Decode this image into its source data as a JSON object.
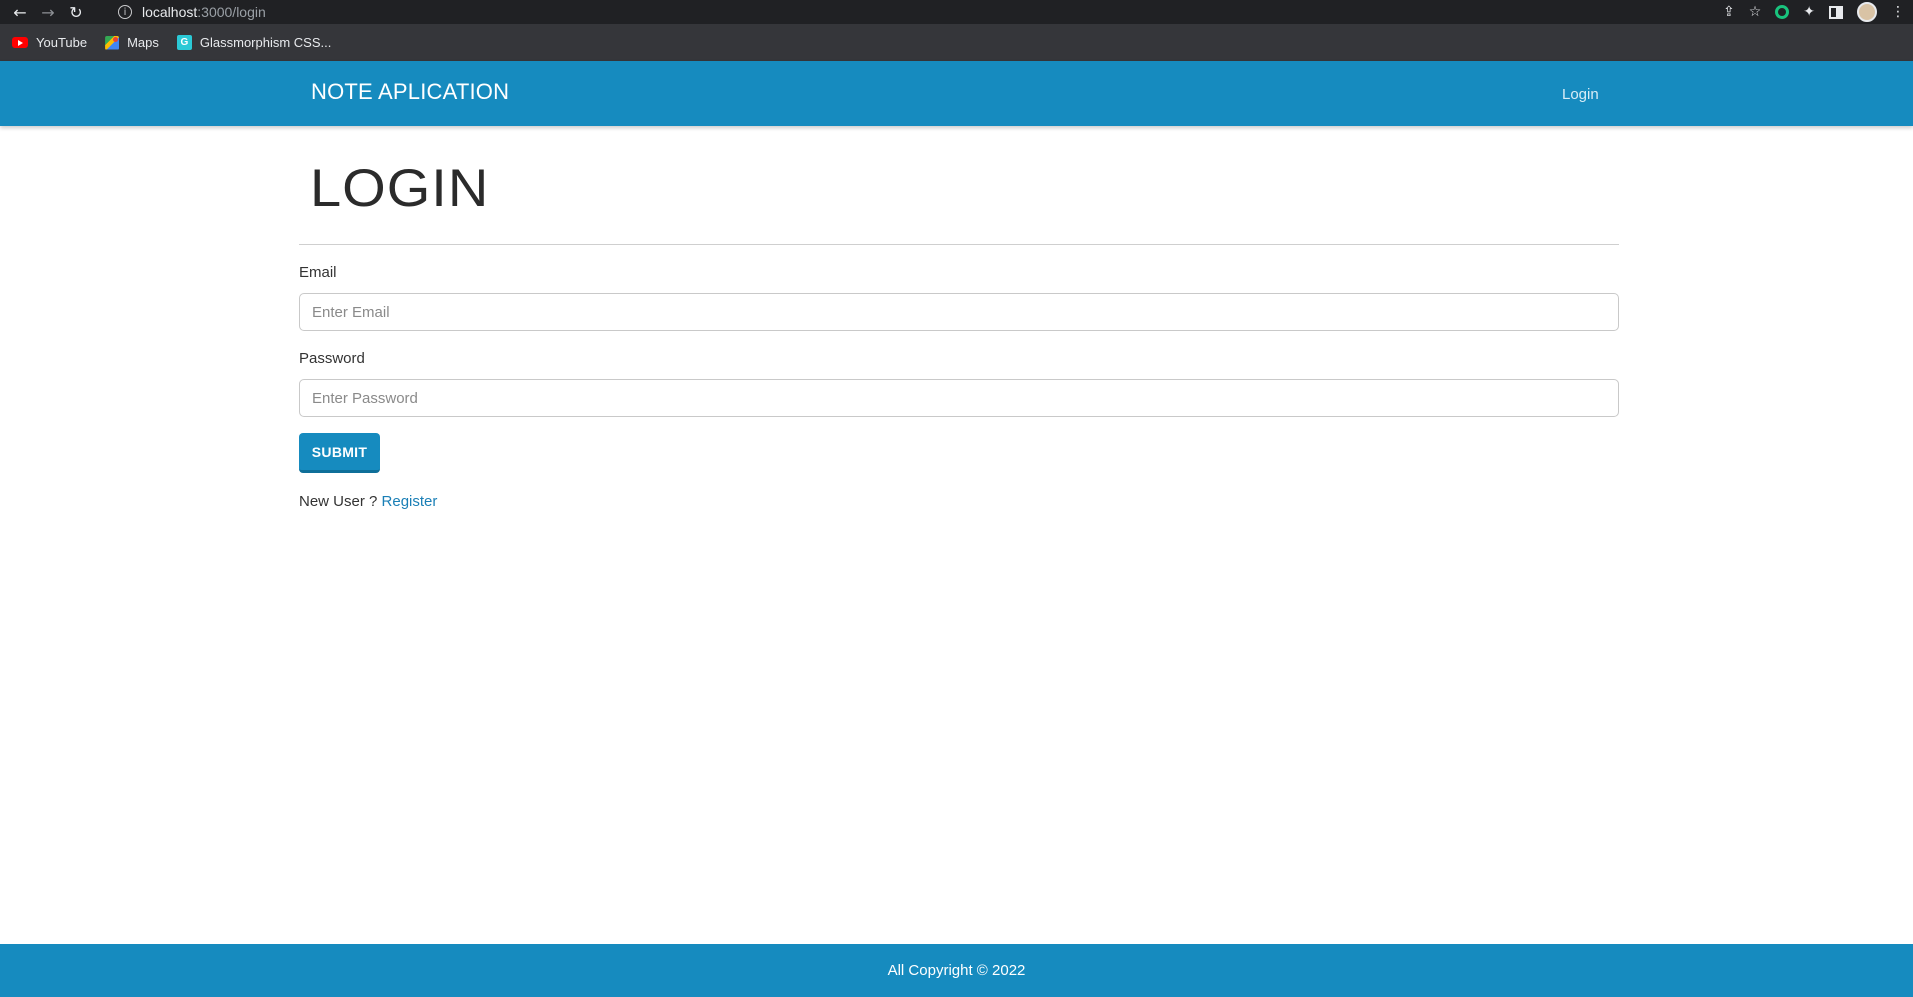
{
  "browser": {
    "url_host": "localhost",
    "url_path": ":3000/login",
    "bookmarks": [
      {
        "label": "YouTube",
        "icon": "youtube-icon"
      },
      {
        "label": "Maps",
        "icon": "maps-icon"
      },
      {
        "label": "Glassmorphism CSS...",
        "icon": "glassmorphism-icon"
      }
    ]
  },
  "navbar": {
    "brand": "NOTE APLICATION",
    "login_link": "Login",
    "color": "#168bbf"
  },
  "main": {
    "title": "LOGIN",
    "email_label": "Email",
    "email_placeholder": "Enter Email",
    "email_value": "",
    "password_label": "Password",
    "password_placeholder": "Enter Password",
    "password_value": "",
    "submit_label": "SUBMIT",
    "new_user_text": "New User ?",
    "register_link": "Register"
  },
  "footer": {
    "text": "All Copyright © 2022"
  }
}
